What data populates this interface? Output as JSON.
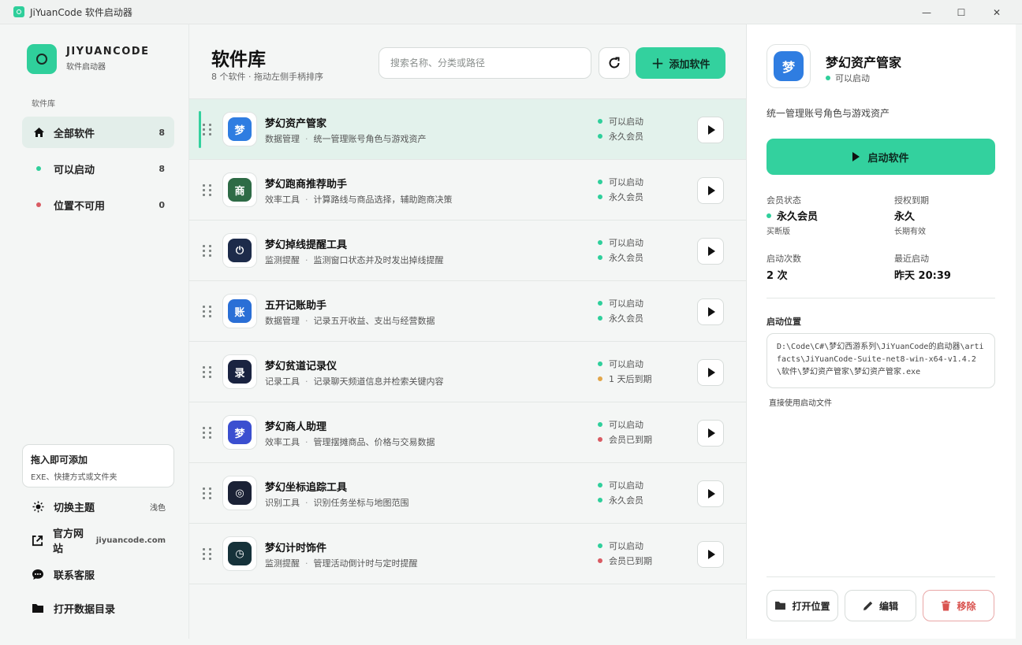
{
  "window": {
    "title": "JiYuanCode 软件启动器",
    "minimize": "—",
    "maximize": "☐",
    "close": "✕"
  },
  "sidebar": {
    "brand": "JIYUANCODE",
    "brand_sub": "软件启动器",
    "section_label": "软件库",
    "nav": [
      {
        "label": "全部软件",
        "count": "8",
        "icon": "home-icon"
      },
      {
        "label": "可以启动",
        "count": "8",
        "color": "#2fcf9b"
      },
      {
        "label": "位置不可用",
        "count": "0",
        "color": "#d95b63"
      }
    ],
    "drop": {
      "title": "拖入即可添加",
      "sub": "EXE、快捷方式或文件夹"
    },
    "theme": {
      "label": "切换主题",
      "value": "浅色"
    },
    "website": {
      "label": "官方网站",
      "value": "jiyuancode.com"
    },
    "support": {
      "label": "联系客服"
    },
    "data_dir": {
      "label": "打开数据目录"
    }
  },
  "main": {
    "title": "软件库",
    "subtitle": "8 个软件 · 拖动左侧手柄排序",
    "search_placeholder": "搜索名称、分类或路径",
    "add_label": "添加软件",
    "items": [
      {
        "name": "梦幻资产管家",
        "category": "数据管理",
        "desc": "统一管理账号角色与游戏资产",
        "status": "可以启动",
        "member": "永久会员",
        "member_color": "#2fcf9b",
        "icon_bg": "#2f7de1",
        "icon_char": "梦"
      },
      {
        "name": "梦幻跑商推荐助手",
        "category": "效率工具",
        "desc": "计算路线与商品选择，辅助跑商决策",
        "status": "可以启动",
        "member": "永久会员",
        "member_color": "#2fcf9b",
        "icon_bg": "#2e6b46",
        "icon_char": "商"
      },
      {
        "name": "梦幻掉线提醒工具",
        "category": "监测提醒",
        "desc": "监测窗口状态并及时发出掉线提醒",
        "status": "可以启动",
        "member": "永久会员",
        "member_color": "#2fcf9b",
        "icon_bg": "#1d2b4a",
        "icon_char": "⏻"
      },
      {
        "name": "五开记账助手",
        "category": "数据管理",
        "desc": "记录五开收益、支出与经营数据",
        "status": "可以启动",
        "member": "永久会员",
        "member_color": "#2fcf9b",
        "icon_bg": "#2a6fd6",
        "icon_char": "账"
      },
      {
        "name": "梦幻贫道记录仪",
        "category": "记录工具",
        "desc": "记录聊天频道信息并检索关键内容",
        "status": "可以启动",
        "member": "1 天后到期",
        "member_color": "#e2a64a",
        "icon_bg": "#1a2340",
        "icon_char": "录"
      },
      {
        "name": "梦幻商人助理",
        "category": "效率工具",
        "desc": "管理摆摊商品、价格与交易数据",
        "status": "可以启动",
        "member": "会员已到期",
        "member_color": "#d95b63",
        "icon_bg": "#3b4fd0",
        "icon_char": "梦"
      },
      {
        "name": "梦幻坐标追踪工具",
        "category": "识别工具",
        "desc": "识别任务坐标与地图范围",
        "status": "可以启动",
        "member": "永久会员",
        "member_color": "#2fcf9b",
        "icon_bg": "#1b2236",
        "icon_char": "◎"
      },
      {
        "name": "梦幻计时饰件",
        "category": "监测提醒",
        "desc": "管理活动倒计时与定时提醒",
        "status": "可以启动",
        "member": "会员已到期",
        "member_color": "#d95b63",
        "icon_bg": "#16323a",
        "icon_char": "◷"
      }
    ]
  },
  "detail": {
    "name": "梦幻资产管家",
    "status": "可以启动",
    "desc": "统一管理账号角色与游戏资产",
    "launch_label": "启动软件",
    "member_label": "会员状态",
    "member_value": "永久会员",
    "member_sub": "买断版",
    "license_label": "授权到期",
    "license_value": "永久",
    "license_sub": "长期有效",
    "count_label": "启动次数",
    "count_value": "2 次",
    "last_label": "最近启动",
    "last_value": "昨天 20:39",
    "path_label": "启动位置",
    "path": "D:\\Code\\C#\\梦幻西游系列\\JiYuanCode的启动器\\artifacts\\JiYuanCode-Suite-net8-win-x64-v1.4.2\\软件\\梦幻资产管家\\梦幻资产管家.exe",
    "path_hint": "直接使用启动文件",
    "open_label": "打开位置",
    "edit_label": "编辑",
    "remove_label": "移除"
  },
  "colors": {
    "accent": "#33d19e",
    "ok": "#2fcf9b",
    "warn": "#e2a64a",
    "bad": "#d95b63"
  }
}
